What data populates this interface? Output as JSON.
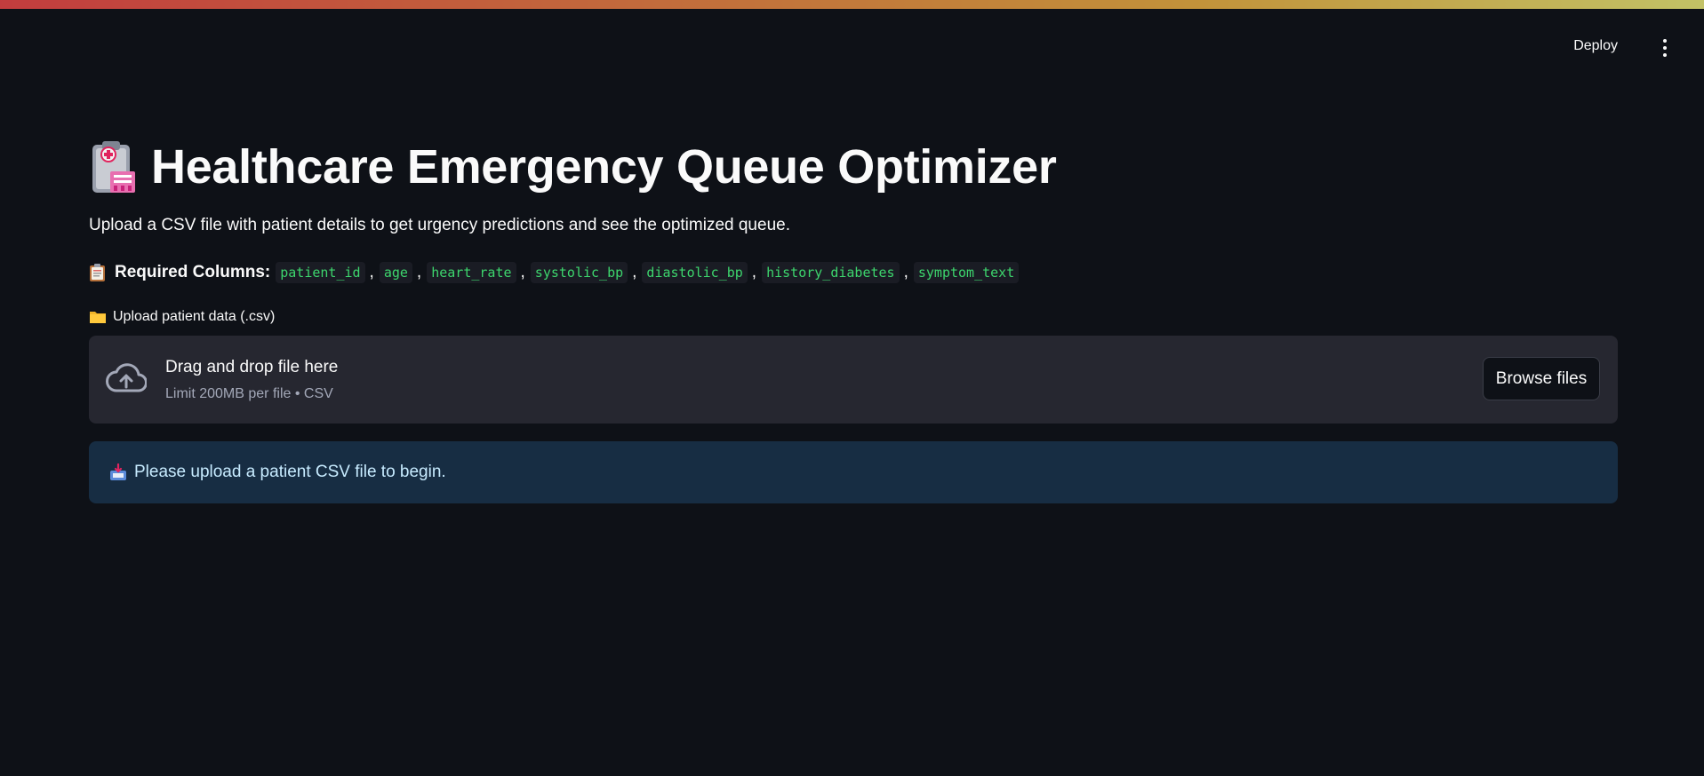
{
  "header": {
    "deploy_label": "Deploy",
    "menu_icon": "kebab-menu-icon"
  },
  "main": {
    "title_icon": "hospital-clipboard-icon",
    "title": "Healthcare Emergency Queue Optimizer",
    "subtitle": "Upload a CSV file with patient details to get urgency predictions and see the optimized queue.",
    "required": {
      "icon": "clipboard-icon",
      "label": "Required Columns:",
      "columns": [
        "patient_id",
        "age",
        "heart_rate",
        "systolic_bp",
        "diastolic_bp",
        "history_diabetes",
        "symptom_text"
      ],
      "separator": ","
    },
    "uploader": {
      "icon": "folder-icon",
      "label": "Upload patient data (.csv)",
      "drop_icon": "cloud-upload-icon",
      "drop_text": "Drag and drop file here",
      "limit_text": "Limit 200MB per file • CSV",
      "browse_label": "Browse files"
    },
    "info": {
      "icon": "inbox-tray-icon",
      "text": "Please upload a patient CSV file to begin."
    }
  },
  "colors": {
    "background": "#0e1117",
    "code_text": "#3dd56d",
    "dropzone_bg": "#262730",
    "info_bg": "#172d43",
    "info_text": "#c7ebff"
  }
}
